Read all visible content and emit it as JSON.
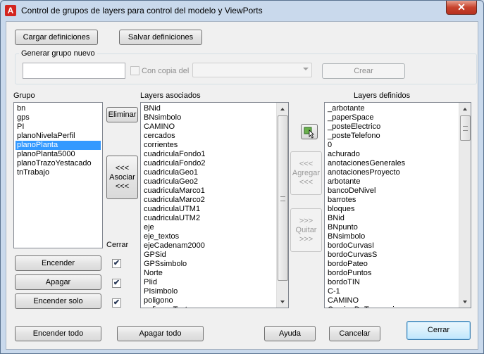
{
  "window": {
    "title": "Control de grupos de layers para control del modelo y ViewPorts",
    "app_icon": "A",
    "close_glyph": "✕"
  },
  "toolbar": {
    "load_label": "Cargar definiciones",
    "save_label": "Salvar definiciones"
  },
  "new_group": {
    "legend": "Generar grupo nuevo",
    "name_value": "",
    "copy_label": "Con copia del",
    "copy_checked": false,
    "copy_select_value": "",
    "create_label": "Crear"
  },
  "groups": {
    "header": "Grupo",
    "items": [
      "bn",
      "gps",
      "PI",
      "planoNivelaPerfil",
      "planoPlanta",
      "planoPlanta5000",
      "planoTrazoYestacado",
      "tnTrabajo"
    ],
    "selected_index": 4
  },
  "middle": {
    "delete_label": "Eliminar",
    "associate_lines": [
      "<<<",
      "Asociar",
      "<<<"
    ],
    "close_header": "Cerrar"
  },
  "associated_layers": {
    "header": "Layers asociados",
    "items": [
      "BNid",
      "BNsimbolo",
      "CAMINO",
      "cercados",
      "corrientes",
      "cuadriculaFondo1",
      "cuadriculaFondo2",
      "cuadriculaGeo1",
      "cuadriculaGeo2",
      "cuadriculaMarco1",
      "cuadriculaMarco2",
      "cuadriculaUTM1",
      "cuadriculaUTM2",
      "eje",
      "eje_textos",
      "ejeCadenam2000",
      "GPSid",
      "GPSsimbolo",
      "Norte",
      "PIid",
      "PIsimbolo",
      "poligono",
      "poligonoTextos"
    ]
  },
  "transfer": {
    "pick_icon": "pick-layer-icon",
    "add_lines": [
      ">>>",
      "Agregar",
      "<<<"
    ],
    "add_lines_display": [
      "<<<",
      "Agregar",
      "<<<"
    ],
    "remove_lines": [
      ">>>",
      "Quitar",
      ">>>"
    ]
  },
  "defined_layers": {
    "header": "Layers definidos",
    "items": [
      "_arbotante",
      "_paperSpace",
      "_posteElectrico",
      "_posteTelefono",
      "0",
      "achurado",
      "anotacionesGenerales",
      "anotacionesProyecto",
      "arbotante",
      "bancoDeNivel",
      "barrotes",
      "bloques",
      "BNid",
      "BNpunto",
      "BNsimbolo",
      "bordoCurvasI",
      "bordoCurvasS",
      "bordoPateo",
      "bordoPuntos",
      "bordoTIN",
      "C-1",
      "CAMINO",
      "CaminoDeTerraceria"
    ]
  },
  "actions": {
    "on_label": "Encender",
    "off_label": "Apagar",
    "on_only_label": "Encender solo",
    "on_checked": true,
    "off_checked": true,
    "on_only_checked": true
  },
  "footer": {
    "all_on_label": "Encender todo",
    "all_off_label": "Apagar todo",
    "help_label": "Ayuda",
    "cancel_label": "Cancelar",
    "close_label": "Cerrar"
  },
  "colors": {
    "selection": "#3399ff",
    "title_bar": "#c9d9ec",
    "close_button": "#c7422c"
  }
}
